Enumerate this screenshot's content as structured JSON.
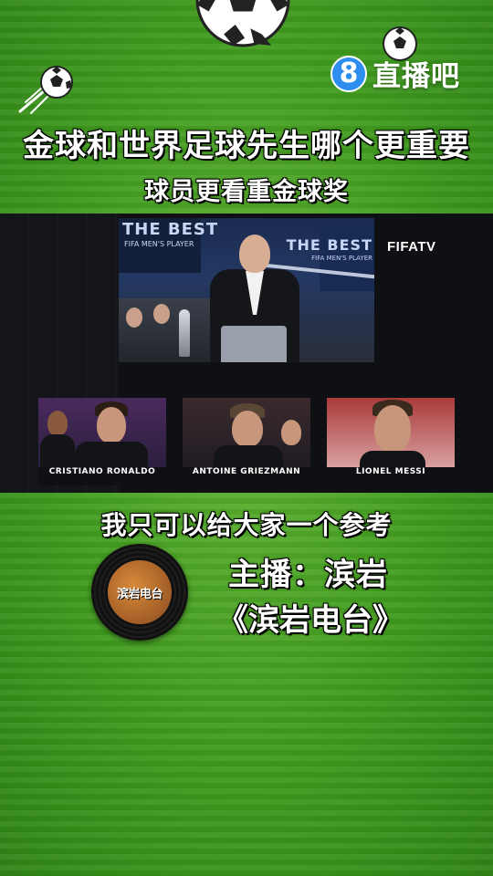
{
  "brand": {
    "number": "8",
    "name": "直播吧"
  },
  "headline": {
    "title": "金球和世界足球先生哪个更重要",
    "subtitle": "球员更看重金球奖"
  },
  "video": {
    "broadcaster": "FIFATV",
    "stage_banner_left": "THE BEST",
    "stage_banner_left_sub": "FIFA MEN'S PLAYER",
    "stage_banner_right": "THE BEST",
    "stage_banner_right_sub": "FIFA MEN'S PLAYER",
    "nominees": [
      {
        "name": "CRISTIANO RONALDO"
      },
      {
        "name": "ANTOINE GRIEZMANN"
      },
      {
        "name": "LIONEL MESSI"
      }
    ]
  },
  "caption": {
    "reference": "我只可以给大家一个参考"
  },
  "host": {
    "anchor": "主播：滨岩",
    "station": "《滨岩电台》",
    "vinyl_label": "滨岩电台"
  },
  "colors": {
    "grass": "#3f9a1e",
    "brand_blue": "#2d8ef0",
    "text": "#ffffff"
  }
}
